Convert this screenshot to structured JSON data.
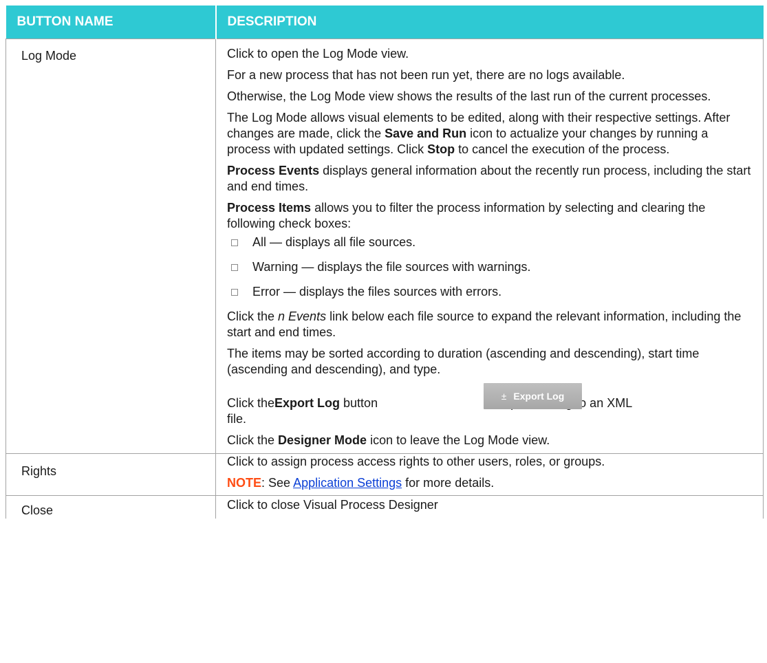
{
  "header": {
    "col1": "BUTTON NAME",
    "col2": "DESCRIPTION"
  },
  "rows": {
    "log_mode": {
      "name": "Log Mode",
      "p1": "Click to open the Log Mode view.",
      "p2": "For a new process that has not been run yet, there are no logs available.",
      "p3": "Otherwise, the Log Mode view shows the results of the last run of the current processes.",
      "p4_a": "The Log Mode allows visual elements to be edited, along with their respective settings. After changes are made, click the ",
      "p4_b": "Save and Run",
      "p4_c": " icon to actualize your changes by running a process with updated settings. Click ",
      "p4_d": "Stop",
      "p4_e": " to cancel the execution of the process.",
      "p5_a": "Process Events",
      "p5_b": " displays general information about the recently run process, including the start and end times.",
      "p6_a": "Process Items",
      "p6_b": " allows you to filter the process information by selecting and clearing the following check boxes:",
      "check1": "All — displays all file sources.",
      "check2": "Warning — displays the file sources with warnings.",
      "check3": "Error — displays the files sources with errors.",
      "p7_a": "Click the ",
      "p7_b": "n Events",
      "p7_c": " link below each file source to expand the relevant information, including the start and end times.",
      "p8": "The items may be sorted according to duration (ascending and descending), start time (ascending and descending), and type.",
      "p9_a": "Click the ",
      "p9_b": "Export Log",
      "p9_c": " button",
      "p9_d": "to export the log to an XML",
      "p9_e": "file.",
      "export_button": {
        "icon": "±",
        "label": "Export Log"
      },
      "p10_a": "Click the ",
      "p10_b": "Designer Mode",
      "p10_c": " icon to leave the Log Mode view."
    },
    "rights": {
      "name": "Rights",
      "p1": "Click to assign process access rights to other users, roles, or groups.",
      "note_label": "NOTE",
      "note_sep": ": See ",
      "note_link": "Application Settings",
      "note_end": " for more details."
    },
    "close": {
      "name": "Close",
      "p1": "Click to close Visual Process Designer"
    }
  },
  "colors": {
    "header_bg": "#2ec9d3",
    "note": "#ff4d14",
    "link": "#0a3fd6"
  }
}
